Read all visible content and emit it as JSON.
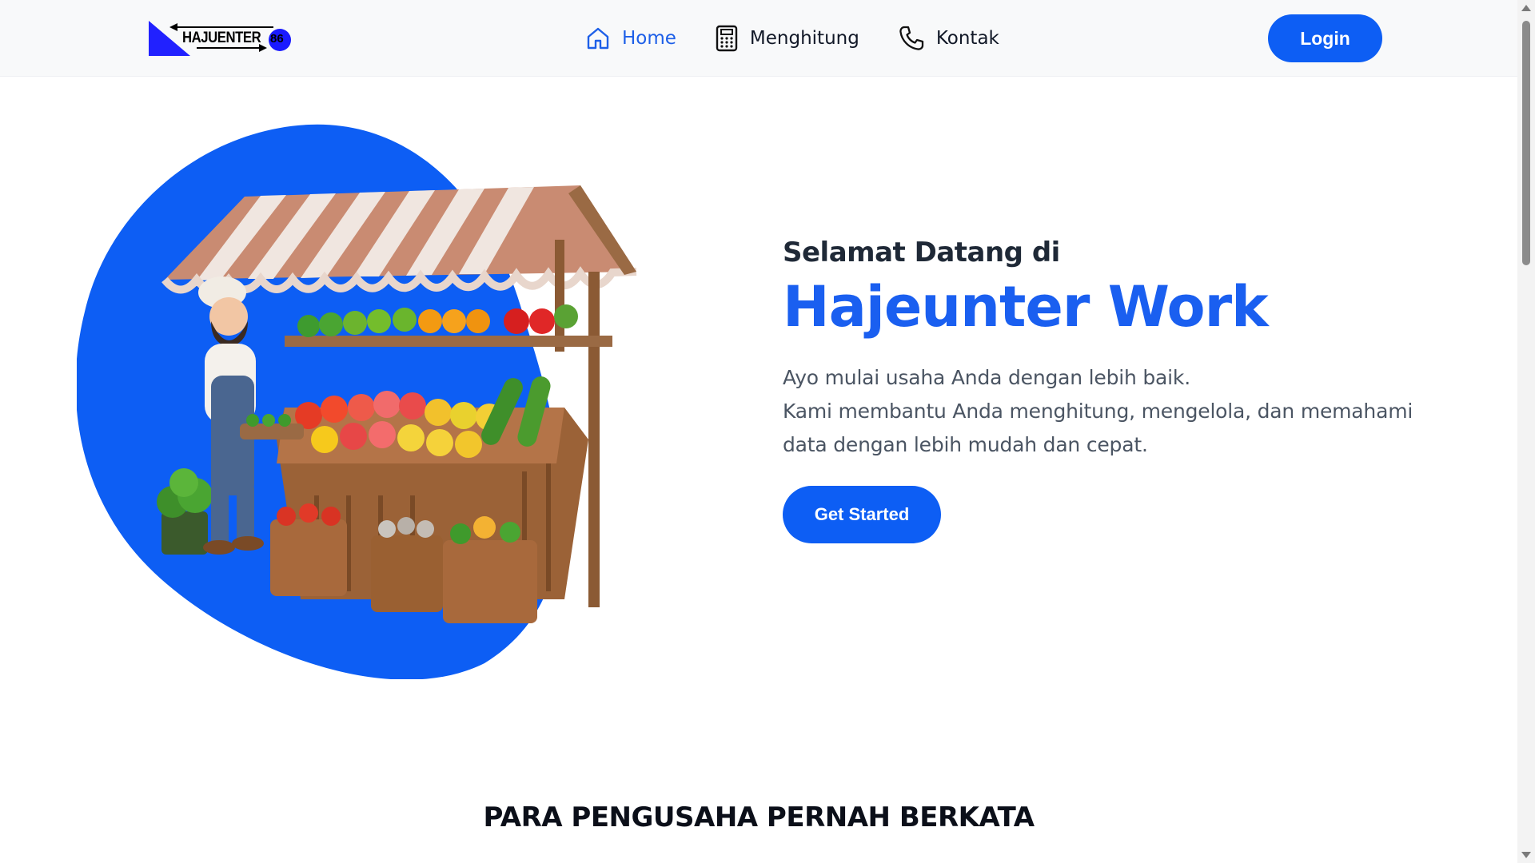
{
  "navbar": {
    "logo_text": "HAJUENTER",
    "logo_number": "86",
    "links": [
      {
        "label": "Home",
        "icon": "home-icon"
      },
      {
        "label": "Menghitung",
        "icon": "calculator-icon"
      },
      {
        "label": "Kontak",
        "icon": "phone-icon"
      }
    ],
    "login_label": "Login"
  },
  "hero": {
    "welcome": "Selamat Datang di",
    "brand": "Hajeunter Work",
    "description_line1": "Ayo mulai usaha Anda dengan lebih baik.",
    "description_line2": "Kami membantu Anda menghitung, mengelola, dan memahami data dengan lebih mudah dan cepat.",
    "cta_label": "Get Started",
    "illustration": "market-stall-illustration"
  },
  "testimonials": {
    "title": "PARA PENGUSAHA PERNAH BERKATA"
  },
  "colors": {
    "accent": "#0d5ef4",
    "brand_text": "#1a5ff0",
    "navbar_bg": "#f8f9fa"
  }
}
